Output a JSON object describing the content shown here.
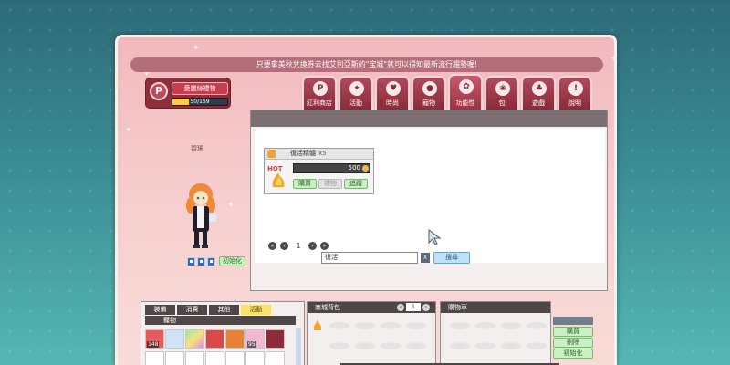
{
  "notice": "只要拿美秋兌換券去找艾利亞斯的\"宝城\"就可以得知最新流行趨勢喔!",
  "favorites": {
    "button_label": "愛麗絲禮物",
    "icon_letter": "P",
    "count": "50/169",
    "progress": 0.296
  },
  "tabs": [
    {
      "label": "紅利商店",
      "icon": "P"
    },
    {
      "label": "活動",
      "icon": "✦"
    },
    {
      "label": "時尚",
      "icon": "♥"
    },
    {
      "label": "寵物",
      "icon": "●"
    },
    {
      "label": "功能性",
      "icon": "✿"
    },
    {
      "label": "包",
      "icon": "❀"
    },
    {
      "label": "遊戲",
      "icon": "♣"
    },
    {
      "label": "說明",
      "icon": "!"
    }
  ],
  "character": {
    "name": "碧瑤",
    "reset_label": "初始化"
  },
  "item": {
    "name": "復活精髓",
    "qty": "x5",
    "price": "500",
    "buy_label": "購買",
    "gift_label": "禮物",
    "track_label": "追蹤",
    "badge": "HOT"
  },
  "pagination": {
    "page": "1"
  },
  "search": {
    "value": "復活",
    "clear_label": "X",
    "button_label": "搜尋"
  },
  "inventory": {
    "tabs": [
      "裝備",
      "消費",
      "其他",
      "活動"
    ],
    "active_tab": 3,
    "sub_label": "寵物",
    "slots": [
      {
        "qty": "148"
      },
      {
        "qty": ""
      },
      {
        "qty": ""
      },
      {
        "qty": ""
      },
      {
        "qty": ""
      },
      {
        "qty": "95"
      },
      {
        "qty": ""
      }
    ]
  },
  "bag": {
    "title": "商城背包",
    "page": "1"
  },
  "cart": {
    "title": "購物車",
    "buy_label": "購買",
    "delete_label": "刪除",
    "reset_label": "初始化"
  }
}
